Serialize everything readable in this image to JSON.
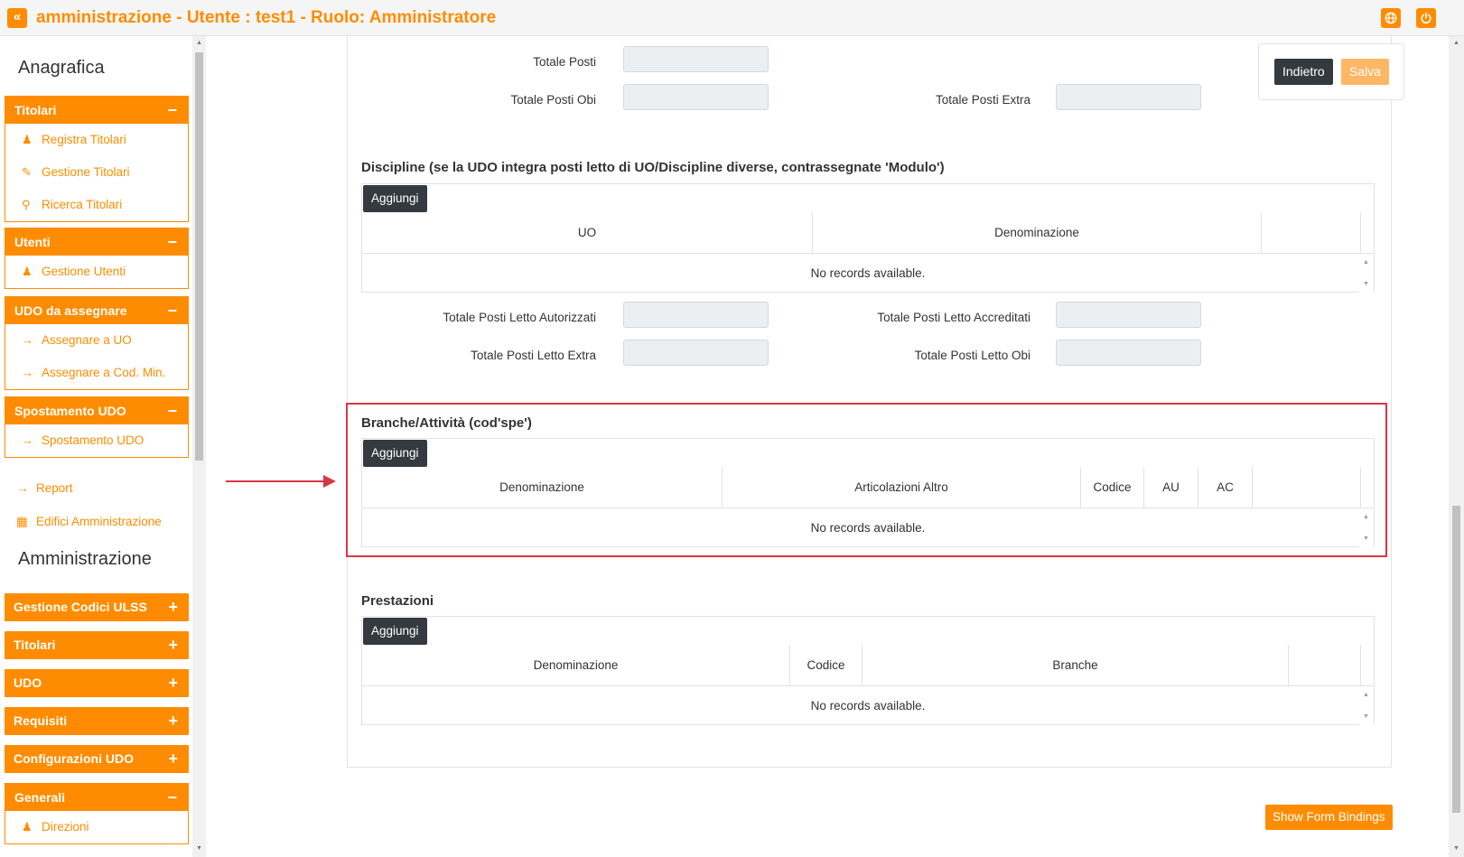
{
  "header": {
    "title": "amministrazione - Utente : test1 - Ruolo: Amministratore",
    "collapse_icon": "«",
    "globe_icon": "globe-icon",
    "power_icon": "power-icon"
  },
  "sidebar": {
    "heading_anagrafica": "Anagrafica",
    "heading_amministrazione": "Amministrazione",
    "groups": [
      {
        "label": "Titolari",
        "toggle": "−",
        "items": [
          {
            "label": "Registra Titolari",
            "icon": "user-edit-icon"
          },
          {
            "label": "Gestione Titolari",
            "icon": "edit-icon"
          },
          {
            "label": "Ricerca Titolari",
            "icon": "search-icon"
          }
        ]
      },
      {
        "label": "Utenti",
        "toggle": "−",
        "items": [
          {
            "label": "Gestione Utenti",
            "icon": "user-edit-icon"
          }
        ]
      },
      {
        "label": "UDO da assegnare",
        "toggle": "−",
        "items": [
          {
            "label": "Assegnare a UO",
            "icon": "arrow-right-icon"
          },
          {
            "label": "Assegnare a Cod. Min.",
            "icon": "arrow-right-icon"
          }
        ]
      },
      {
        "label": "Spostamento UDO",
        "toggle": "−",
        "items": [
          {
            "label": "Spostamento UDO",
            "icon": "arrow-right-icon"
          }
        ]
      }
    ],
    "links": [
      {
        "label": "Report",
        "icon": "arrow-right-icon"
      },
      {
        "label": "Edifici Amministrazione",
        "icon": "building-icon"
      }
    ],
    "admin_groups": [
      {
        "label": "Gestione Codici ULSS",
        "toggle": "+"
      },
      {
        "label": "Titolari",
        "toggle": "+"
      },
      {
        "label": "UDO",
        "toggle": "+"
      },
      {
        "label": "Requisiti",
        "toggle": "+"
      },
      {
        "label": "Configurazioni UDO",
        "toggle": "+"
      }
    ],
    "generali": {
      "label": "Generali",
      "toggle": "−",
      "items": [
        {
          "label": "Direzioni",
          "icon": "user-edit-icon"
        }
      ]
    }
  },
  "form": {
    "totale_posti": "Totale Posti",
    "totale_posti_obi": "Totale Posti Obi",
    "totale_posti_extra": "Totale Posti Extra",
    "discipline_title": "Discipline (se la UDO integra posti letto di UO/Discipline diverse, contrassegnate 'Modulo')",
    "add_label": "Aggiungi",
    "no_records": "No records available.",
    "discipline_columns": [
      "UO",
      "Denominazione"
    ],
    "totale_pl_autorizzati": "Totale Posti Letto Autorizzati",
    "totale_pl_accreditati": "Totale Posti Letto Accreditati",
    "totale_pl_extra": "Totale Posti Letto Extra",
    "totale_pl_obi": "Totale Posti Letto Obi",
    "branche_title": "Branche/Attività (cod'spe')",
    "branche_columns": [
      "Denominazione",
      "Articolazioni Altro",
      "Codice",
      "AU",
      "AC"
    ],
    "prestazioni_title": "Prestazioni",
    "prestazioni_columns": [
      "Denominazione",
      "Codice",
      "Branche"
    ]
  },
  "actions": {
    "back": "Indietro",
    "save": "Salva",
    "show_bindings": "Show Form Bindings"
  },
  "colors": {
    "accent": "#ff8c00",
    "dark_button": "#343a40",
    "highlight": "#dc3545"
  }
}
